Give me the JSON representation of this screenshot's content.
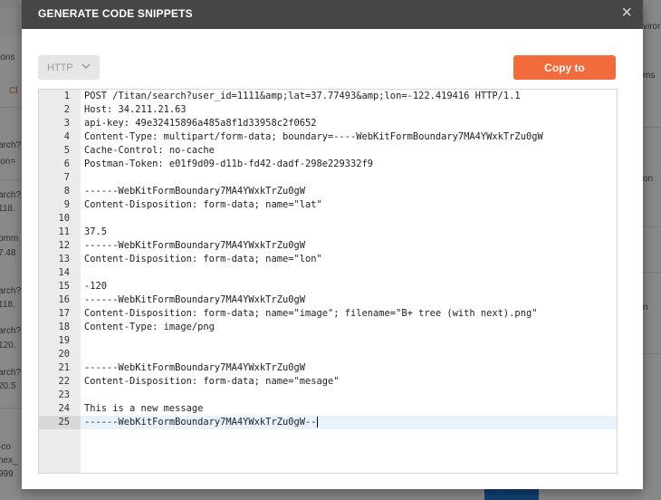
{
  "background": {
    "left_snippets": [
      "ions",
      "Cl",
      "arch?",
      "lon=",
      "arch?",
      "118.",
      "omm",
      "7.48",
      "arch?",
      "118.",
      "arch?",
      "120.",
      "arch?",
      "20.5",
      "-co",
      "hex_",
      "999"
    ],
    "right_snippets": [
      "vironi",
      "ms",
      "on",
      "n"
    ]
  },
  "modal": {
    "title": "GENERATE CODE SNIPPETS",
    "close_symbol": "×",
    "language": "HTTP",
    "copy_label": "Copy to Clipboard"
  },
  "editor": {
    "active_line": 25,
    "lines": [
      {
        "n": "1",
        "code": "POST /Titan/search?user_id=1111&amp;lat=37.77493&amp;lon=-122.419416 HTTP/1.1"
      },
      {
        "n": "2",
        "code": "Host: 34.211.21.63"
      },
      {
        "n": "3",
        "code": "api-key: 49e32415896a485a8f1d33958c2f0652"
      },
      {
        "n": "4",
        "code": "Content-Type: multipart/form-data; boundary=----WebKitFormBoundary7MA4YWxkTrZu0gW"
      },
      {
        "n": "5",
        "code": "Cache-Control: no-cache"
      },
      {
        "n": "6",
        "code": "Postman-Token: e01f9d09-d11b-fd42-dadf-298e229332f9"
      },
      {
        "n": "7",
        "code": ""
      },
      {
        "n": "8",
        "code": "------WebKitFormBoundary7MA4YWxkTrZu0gW"
      },
      {
        "n": "9",
        "code": "Content-Disposition: form-data; name=\"lat\""
      },
      {
        "n": "10",
        "code": ""
      },
      {
        "n": "11",
        "code": "37.5"
      },
      {
        "n": "12",
        "code": "------WebKitFormBoundary7MA4YWxkTrZu0gW"
      },
      {
        "n": "13",
        "code": "Content-Disposition: form-data; name=\"lon\""
      },
      {
        "n": "14",
        "code": ""
      },
      {
        "n": "15",
        "code": "-120"
      },
      {
        "n": "16",
        "code": "------WebKitFormBoundary7MA4YWxkTrZu0gW"
      },
      {
        "n": "17",
        "code": "Content-Disposition: form-data; name=\"image\"; filename=\"B+ tree (with next).png\""
      },
      {
        "n": "18",
        "code": "Content-Type: image/png"
      },
      {
        "n": "19",
        "code": ""
      },
      {
        "n": "20",
        "code": ""
      },
      {
        "n": "21",
        "code": "------WebKitFormBoundary7MA4YWxkTrZu0gW"
      },
      {
        "n": "22",
        "code": "Content-Disposition: form-data; name=\"mesage\""
      },
      {
        "n": "23",
        "code": ""
      },
      {
        "n": "24",
        "code": "This is a new message"
      },
      {
        "n": "25",
        "code": "------WebKitFormBoundary7MA4YWxkTrZu0gW--"
      }
    ]
  },
  "colors": {
    "header_bg": "#464646",
    "accent_orange": "#f26b3a",
    "gutter_bg": "#ebebeb",
    "active_line_bg": "#e8f2fb"
  },
  "icons": {
    "close": "close-icon",
    "dropdown": "chevron-down-icon"
  }
}
